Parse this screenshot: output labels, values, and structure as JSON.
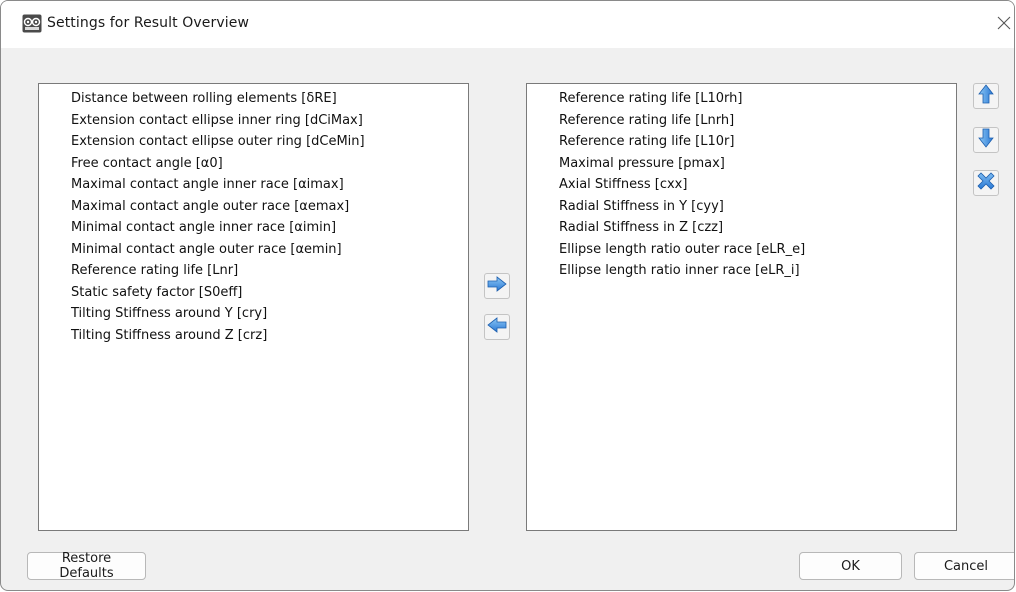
{
  "window": {
    "title": "Settings for Result Overview"
  },
  "available_list": {
    "items": [
      "Distance between rolling elements [δRE]",
      "Extension contact ellipse inner ring [dCiMax]",
      "Extension contact ellipse outer ring [dCeMin]",
      "Free contact angle [α0]",
      "Maximal contact angle inner race [αimax]",
      "Maximal contact angle outer race [αemax]",
      "Minimal contact angle inner race [αimin]",
      "Minimal contact angle outer race [αemin]",
      "Reference rating life [Lnr]",
      "Static safety factor [S0eff]",
      "Tilting Stiffness around Y [cry]",
      "Tilting Stiffness around Z [crz]"
    ]
  },
  "selected_list": {
    "items": [
      "Reference rating life [L10rh]",
      "Reference rating life [Lnrh]",
      "Reference rating life [L10r]",
      "Maximal pressure [pmax]",
      "Axial Stiffness [cxx]",
      "Radial Stiffness in Y [cyy]",
      "Radial Stiffness in Z [czz]",
      "Ellipse length ratio outer race [eLR_e]",
      "Ellipse length ratio inner race [eLR_i]"
    ]
  },
  "buttons": {
    "restore_defaults": "Restore Defaults",
    "ok": "OK",
    "cancel": "Cancel"
  },
  "icons": {
    "add": "arrow-right-icon",
    "remove": "arrow-left-icon",
    "move_up": "arrow-up-icon",
    "move_down": "arrow-down-icon",
    "delete": "delete-x-icon",
    "close": "close-icon",
    "app": "app-logo-icon"
  },
  "colors": {
    "icon_blue": "#2f7fd8",
    "icon_blue_light": "#6fb3f0",
    "window_bg": "#f0f0f0",
    "list_bg": "#ffffff"
  }
}
